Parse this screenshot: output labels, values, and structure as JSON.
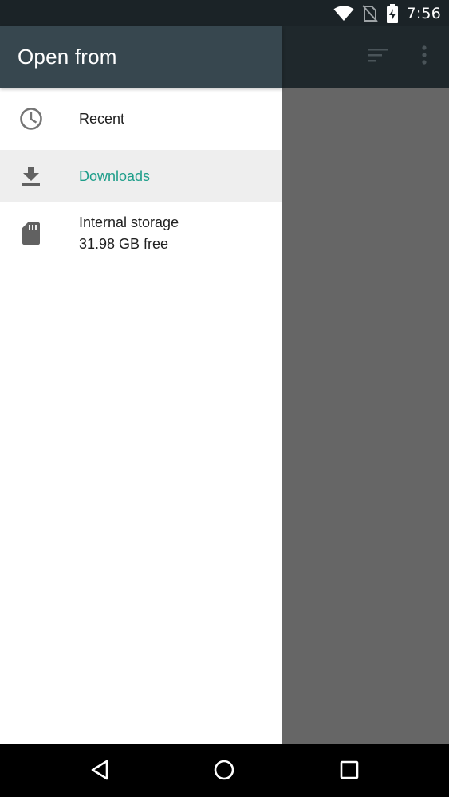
{
  "status_bar": {
    "time": "7:56",
    "icons": [
      "wifi-icon",
      "no-sim-icon",
      "battery-charging-icon"
    ]
  },
  "app_bar": {
    "actions": [
      "sort-icon",
      "overflow-menu-icon"
    ]
  },
  "drawer": {
    "title": "Open from",
    "roots": [
      {
        "label": "Recent",
        "icon": "clock-icon",
        "selected": false
      },
      {
        "label": "Downloads",
        "icon": "download-icon",
        "selected": true
      },
      {
        "label": "Internal storage",
        "subtitle": "31.98 GB free",
        "icon": "sd-card-icon",
        "selected": false
      }
    ]
  },
  "nav_bar": {
    "buttons": [
      "back-icon",
      "home-icon",
      "recents-icon"
    ]
  },
  "colors": {
    "header": "#37474f",
    "status_bar": "#1b2327",
    "accent": "#1e9e8a",
    "scrim": "#666666",
    "selected_row": "#eeeeee"
  }
}
